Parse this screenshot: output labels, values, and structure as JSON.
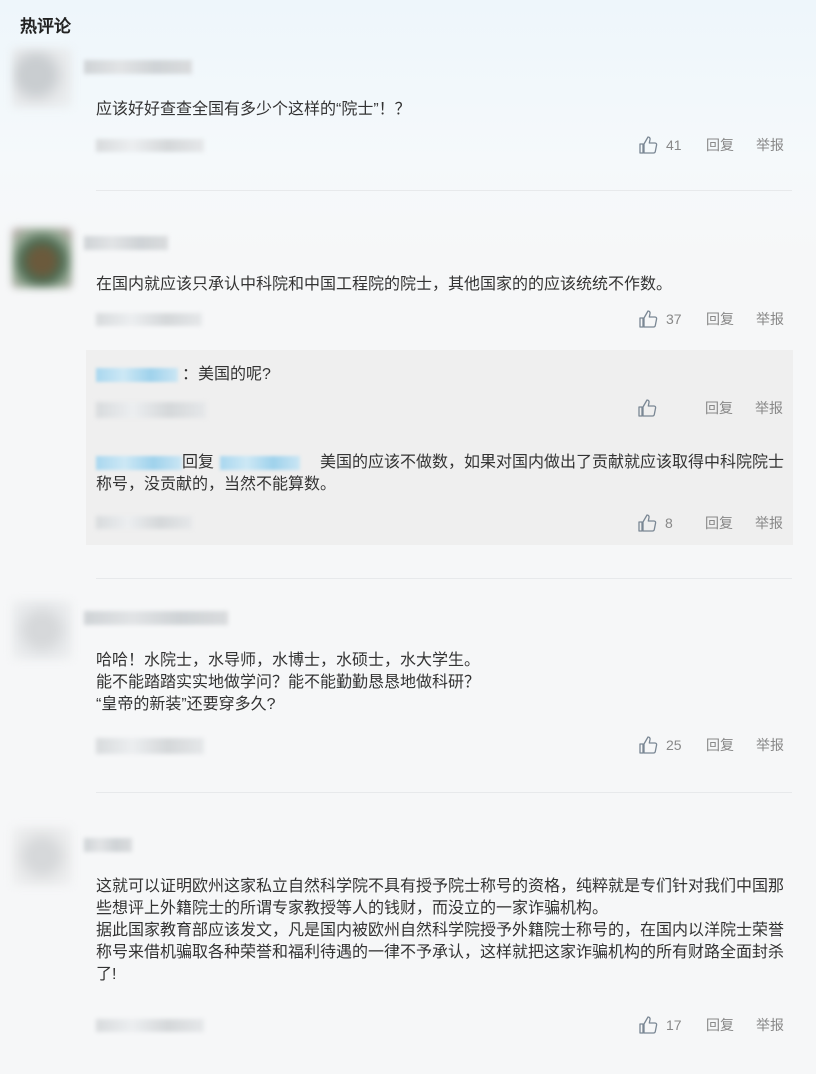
{
  "section": {
    "title": "热评论"
  },
  "comments": [
    {
      "content": "应该好好查查全国有多少个这样的“院士”！？",
      "likes": "41"
    },
    {
      "content": "在国内就应该只承认中科院和中国工程院的院士，其他国家的的应该统统不作数。",
      "likes": "37",
      "replies": [
        {
          "content": "：美国的呢?",
          "likes": ""
        },
        {
          "reply_word": "回复",
          "content": "美国的应该不做数，如果对国内做出了贡献就应该取得中科院院士称号，没贡献的，当然不能算数。",
          "likes": "8"
        }
      ]
    },
    {
      "content": "哈哈！水院士，水导师，水博士，水硕士，水大学生。\n能不能踏踏实实地做学问？能不能勤勤恳恳地做科研？\n“皇帝的新装”还要穿多久?",
      "likes": "25"
    },
    {
      "content": "这就可以证明欧州这家私立自然科学院不具有授予院士称号的资格，纯粹就是专们针对我们中国那些想评上外籍院士的所谓专家教授等人的钱财，而没立的一家诈骗机构。\n据此国家教育部应该发文，凡是国内被欧州自然科学院授予外籍院士称号的，在国内以洋院士荣誉称号来借机骗取各种荣誉和福利待遇的一律不予承认，这样就把这家诈骗机构的所有财路全面封杀了!",
      "likes": "17"
    }
  ],
  "actions": {
    "reply": "回复",
    "report": "举报"
  },
  "icons": {
    "like": "thumbs-up-icon"
  },
  "colors": {
    "accent_blue": "#a9d7ef",
    "action_gray": "#888888",
    "reply_bg": "#efefef"
  }
}
